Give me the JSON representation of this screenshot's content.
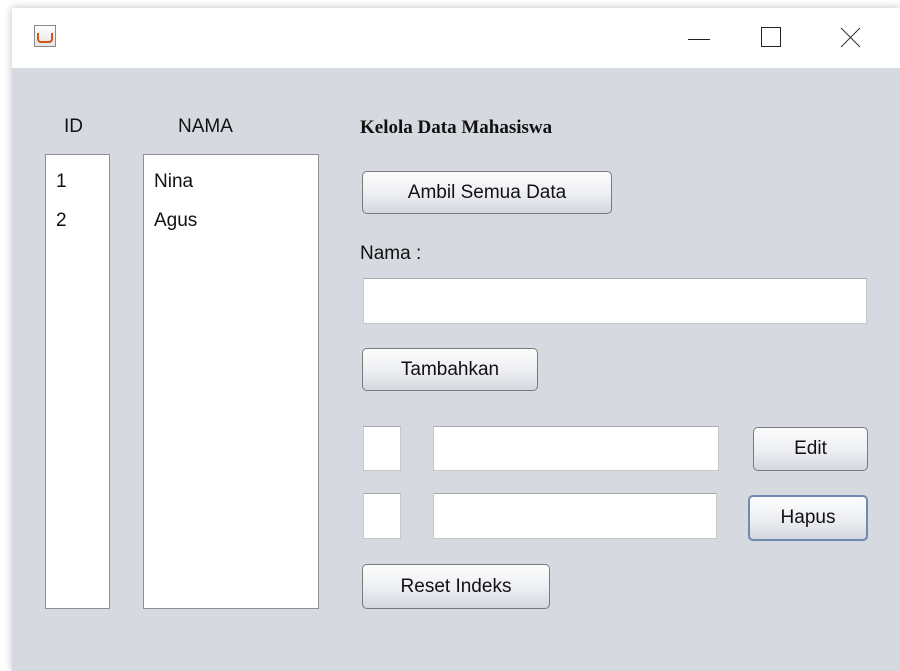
{
  "window": {
    "app_icon": "java-cup-icon",
    "controls": [
      "minimize-icon",
      "maximize-icon",
      "close-icon"
    ]
  },
  "columns": {
    "id_header": "ID",
    "nama_header": "NAMA"
  },
  "id_list": [
    "1",
    "2"
  ],
  "nama_list": [
    "Nina",
    "Agus"
  ],
  "form": {
    "heading": "Kelola Data Mahasiswa",
    "ambil_button": "Ambil Semua Data",
    "nama_label": "Nama :",
    "nama_value": "",
    "tambah_button": "Tambahkan",
    "edit_id_value": "",
    "edit_nama_value": "",
    "edit_button": "Edit",
    "hapus_id_value": "",
    "hapus_nama_value": "",
    "hapus_button": "Hapus",
    "reset_button": "Reset Indeks"
  }
}
